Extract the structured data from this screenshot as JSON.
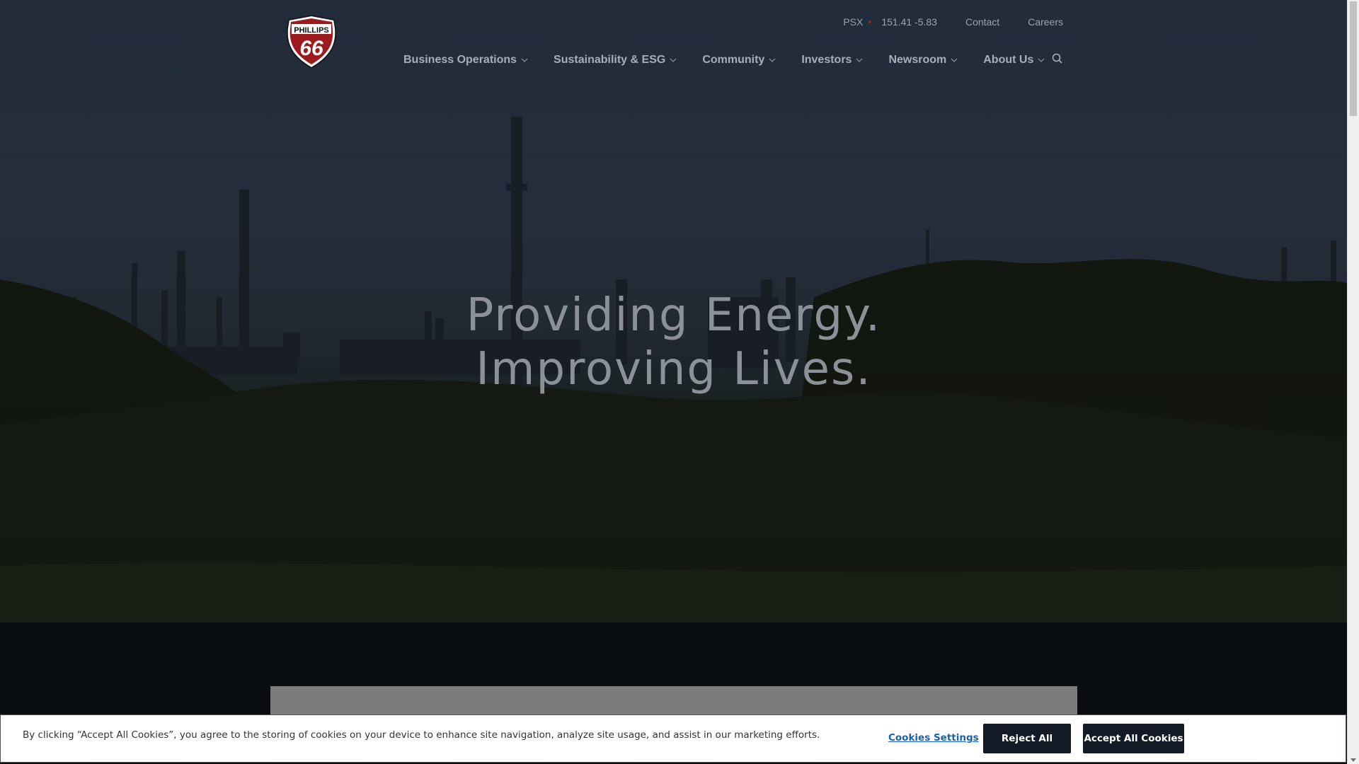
{
  "brand": {
    "logo_top": "PHILLIPS",
    "logo_number": "66",
    "accent": "#c8102e"
  },
  "utility": {
    "ticker_symbol": "PSX",
    "ticker_value": "151.41 -5.83",
    "links": [
      "Contact",
      "Careers"
    ]
  },
  "nav": {
    "items": [
      "Business Operations",
      "Sustainability & ESG",
      "Community",
      "Investors",
      "Newsroom",
      "About Us"
    ],
    "search_icon": "search-icon"
  },
  "hero": {
    "line1": "Providing Energy.",
    "line2": "Improving Lives."
  },
  "cookie_banner": {
    "text": "By clicking “Accept All Cookies”, you agree to the storing of cookies on your device to enhance site navigation, analyze site usage, and assist in our marketing efforts.",
    "settings_label": "Cookies Settings",
    "reject_label": "Reject All",
    "accept_label": "Accept All Cookies"
  }
}
